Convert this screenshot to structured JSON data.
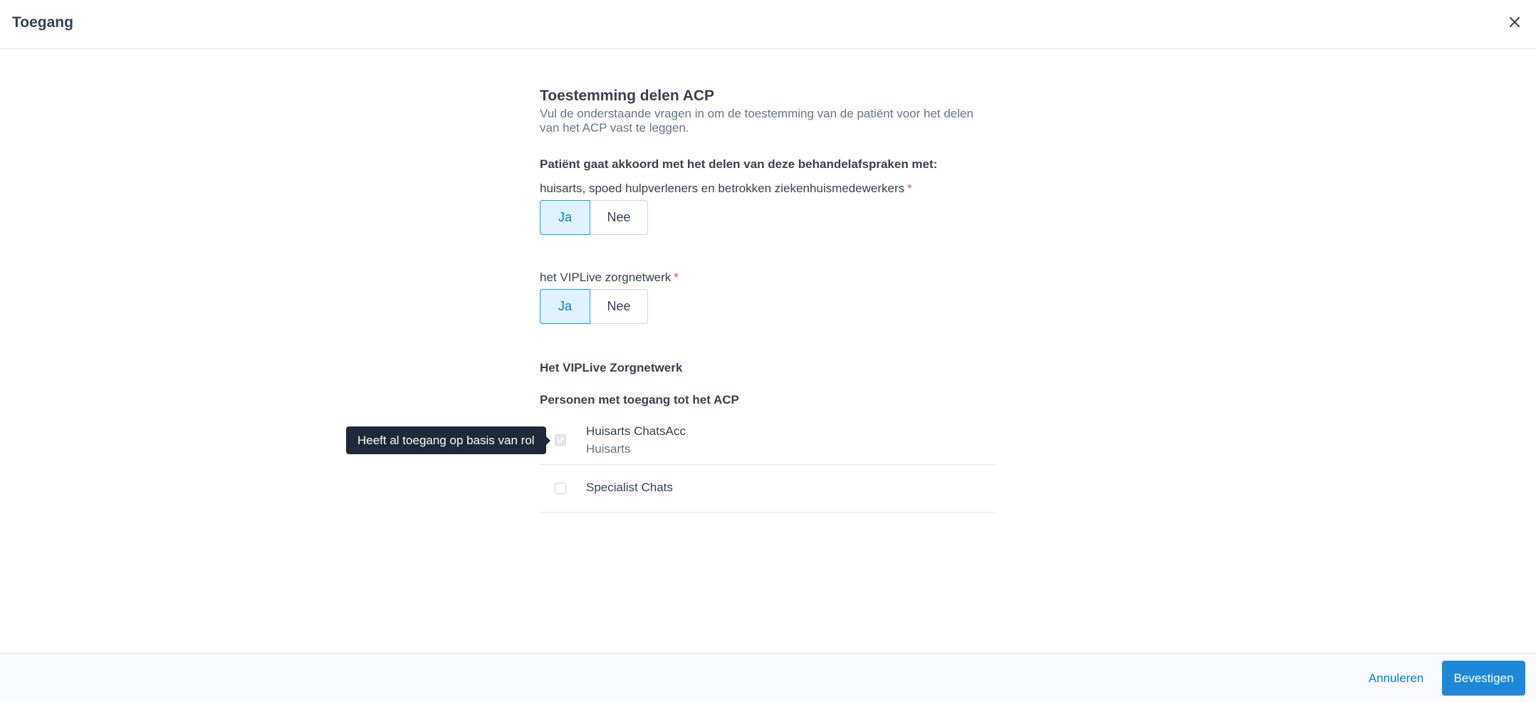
{
  "header": {
    "title": "Toegang",
    "close_icon": "close-icon"
  },
  "form": {
    "title": "Toestemming delen ACP",
    "description": "Vul de onderstaande vragen in om de toestemming van de patiënt voor het delen van het ACP vast te leggen.",
    "question_heading": "Patiënt gaat akkoord met het delen van deze behandelafspraken met:",
    "questions": [
      {
        "label": "huisarts, spoed hulpverleners en betrokken ziekenhuismedewerkers",
        "required_mark": "*",
        "options": [
          "Ja",
          "Nee"
        ],
        "selected": "Ja"
      },
      {
        "label": "het VIPLive zorgnetwerk",
        "required_mark": "*",
        "options": [
          "Ja",
          "Nee"
        ],
        "selected": "Ja"
      }
    ],
    "network": {
      "heading": "Het VIPLive Zorgnetwerk",
      "subheading": "Personen met toegang tot het ACP",
      "persons": [
        {
          "name": "Huisarts ChatsAcc",
          "role": "Huisarts",
          "checked": true,
          "disabled": true
        },
        {
          "name": "Specialist Chats",
          "checked": false,
          "disabled": false
        }
      ]
    },
    "tooltip": "Heeft al toegang op basis van rol"
  },
  "footer": {
    "cancel_label": "Annuleren",
    "confirm_label": "Bevestigen"
  },
  "colors": {
    "accent": "#1e88d8",
    "selected_bg": "#e0f2fe",
    "required": "#ef4444"
  }
}
